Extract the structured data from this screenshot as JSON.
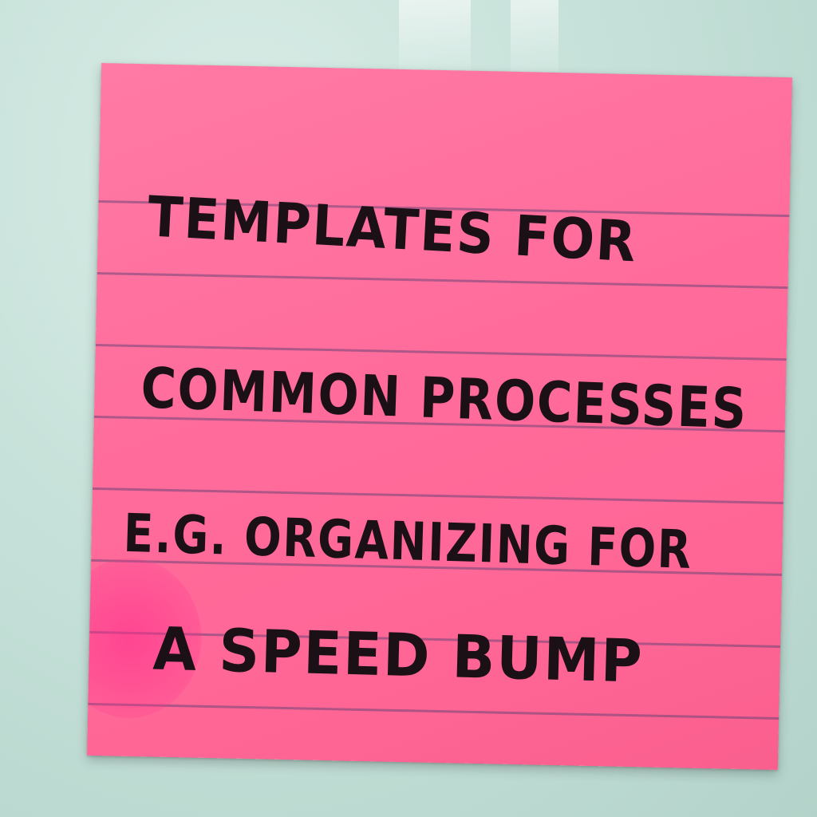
{
  "note": {
    "color": "#ff6d9c",
    "lines": [
      "TEMPLATES FOR",
      "COMMON PROCESSES",
      "E.G. ORGANIZING FOR",
      "A SPEED BUMP"
    ]
  }
}
